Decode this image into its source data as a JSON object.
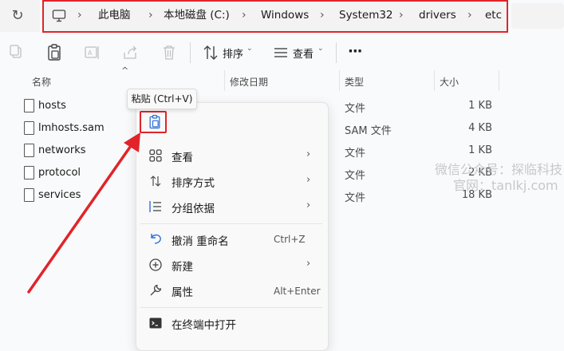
{
  "address_bar": {
    "crumbs": [
      "此电脑",
      "本地磁盘 (C:)",
      "Windows",
      "System32",
      "drivers",
      "etc"
    ]
  },
  "toolbar": {
    "sort_label": "排序",
    "view_label": "查看",
    "more_label": "···"
  },
  "columns": {
    "name": "名称",
    "modified": "修改日期",
    "type": "类型",
    "size": "大小"
  },
  "files": [
    {
      "name": "hosts",
      "type": "文件",
      "size": "1 KB"
    },
    {
      "name": "lmhosts.sam",
      "type": "SAM 文件",
      "size": "4 KB"
    },
    {
      "name": "networks",
      "type": "文件",
      "size": "1 KB"
    },
    {
      "name": "protocol",
      "type": "文件",
      "size": "2 KB"
    },
    {
      "name": "services",
      "type": "文件",
      "size": "18 KB"
    }
  ],
  "tooltip": "粘贴 (Ctrl+V)",
  "context_menu": {
    "view": "查看",
    "sort": "排序方式",
    "group": "分组依据",
    "undo": "撤消 重命名",
    "undo_shortcut": "Ctrl+Z",
    "new": "新建",
    "properties": "属性",
    "properties_shortcut": "Alt+Enter",
    "open_terminal": "在终端中打开"
  },
  "watermark": {
    "line1": "微信公众号：探临科技",
    "line2": "官网：tanlkj.com"
  },
  "colors": {
    "highlight_red": "#e0242a",
    "background": "#f9fafb"
  }
}
